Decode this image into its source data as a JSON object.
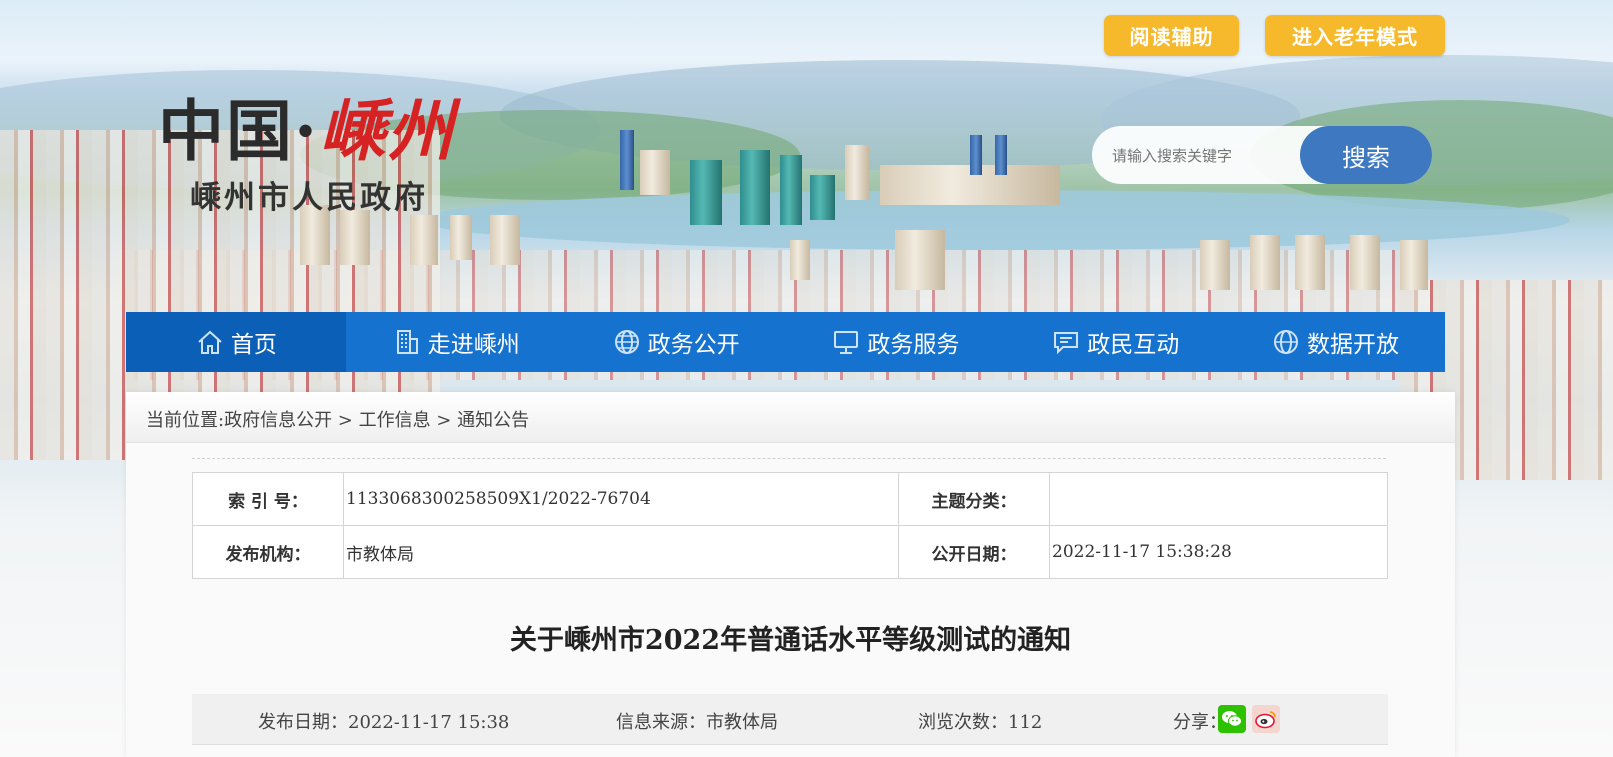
{
  "header": {
    "reading_aid_label": "阅读辅助",
    "elder_mode_label": "进入老年模式",
    "logo_main_part1": "中国",
    "logo_dot": "·",
    "logo_main_part2": "嵊州",
    "logo_sub": "嵊州市人民政府",
    "search_placeholder": "请输入搜索关键字",
    "search_button_label": "搜索"
  },
  "nav": {
    "items": [
      {
        "label": "首页",
        "icon": "home-icon"
      },
      {
        "label": "走进嵊州",
        "icon": "building-icon"
      },
      {
        "label": "政务公开",
        "icon": "globe-icon"
      },
      {
        "label": "政务服务",
        "icon": "monitor-icon"
      },
      {
        "label": "政民互动",
        "icon": "chat-icon"
      },
      {
        "label": "数据开放",
        "icon": "globe-data-icon"
      }
    ]
  },
  "breadcrumb": {
    "prefix": "当前位置:",
    "path1": "政府信息公开",
    "sep": " > ",
    "path2": "工作信息",
    "path3": "通知公告"
  },
  "meta": {
    "index_label": "索 引 号：",
    "index_value": "1133068300258509X1/2022-76704",
    "topic_label": "主题分类：",
    "topic_value": "",
    "publisher_label": "发布机构：",
    "publisher_value": "市教体局",
    "open_date_label": "公开日期：",
    "open_date_value": "2022-11-17 15:38:28"
  },
  "article": {
    "title": "关于嵊州市2022年普通话水平等级测试的通知",
    "publish_date": "发布日期：2022-11-17 15:38",
    "source": "信息来源：市教体局",
    "views": "浏览次数：112",
    "share_label": "分享："
  },
  "colors": {
    "nav_bg": "#1572cf",
    "accent_button": "#f7b92c",
    "search_button": "#3d78c0",
    "wechat_green": "#2dc100",
    "weibo_red": "#e6162d"
  }
}
